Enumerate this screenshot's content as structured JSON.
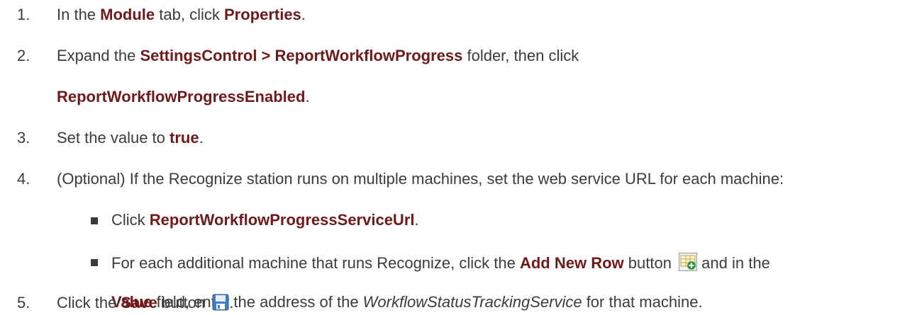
{
  "steps": [
    {
      "number": "1.",
      "lines": [
        [
          "In the ",
          {
            "b": "Module"
          },
          " tab, click ",
          {
            "b": "Properties"
          },
          "."
        ]
      ]
    },
    {
      "number": "2.",
      "lines": [
        [
          "Expand the ",
          {
            "b": "SettingsControl > ReportWorkflowProgress"
          },
          " folder, then click"
        ],
        [
          {
            "b": "ReportWorkflowProgressEnabled"
          },
          "."
        ]
      ]
    },
    {
      "number": "3.",
      "lines": [
        [
          "Set the value to ",
          {
            "b": "true"
          },
          "."
        ]
      ]
    },
    {
      "number": "4.",
      "lines": [
        [
          "(Optional) If the Recognize station runs on multiple machines, set the web service URL for each machine:"
        ]
      ],
      "sub": [
        {
          "lines": [
            [
              "Click ",
              {
                "b": "ReportWorkflowProgressServiceUrl"
              },
              "."
            ]
          ]
        },
        {
          "lines": [
            [
              "For each additional machine that runs Recognize, click the ",
              {
                "b": "Add New Row"
              },
              " button ",
              {
                "icon": "add-new-row-icon"
              },
              " and in the"
            ],
            [
              {
                "b": "Value"
              },
              " field, enter the address of the ",
              {
                "i": "WorkflowStatusTrackingService"
              },
              " for that machine."
            ]
          ]
        }
      ]
    },
    {
      "number": "5.",
      "lines": [
        [
          "Click the ",
          {
            "b": "Save"
          },
          " button ",
          {
            "icon": "save-icon"
          },
          "."
        ]
      ]
    }
  ]
}
